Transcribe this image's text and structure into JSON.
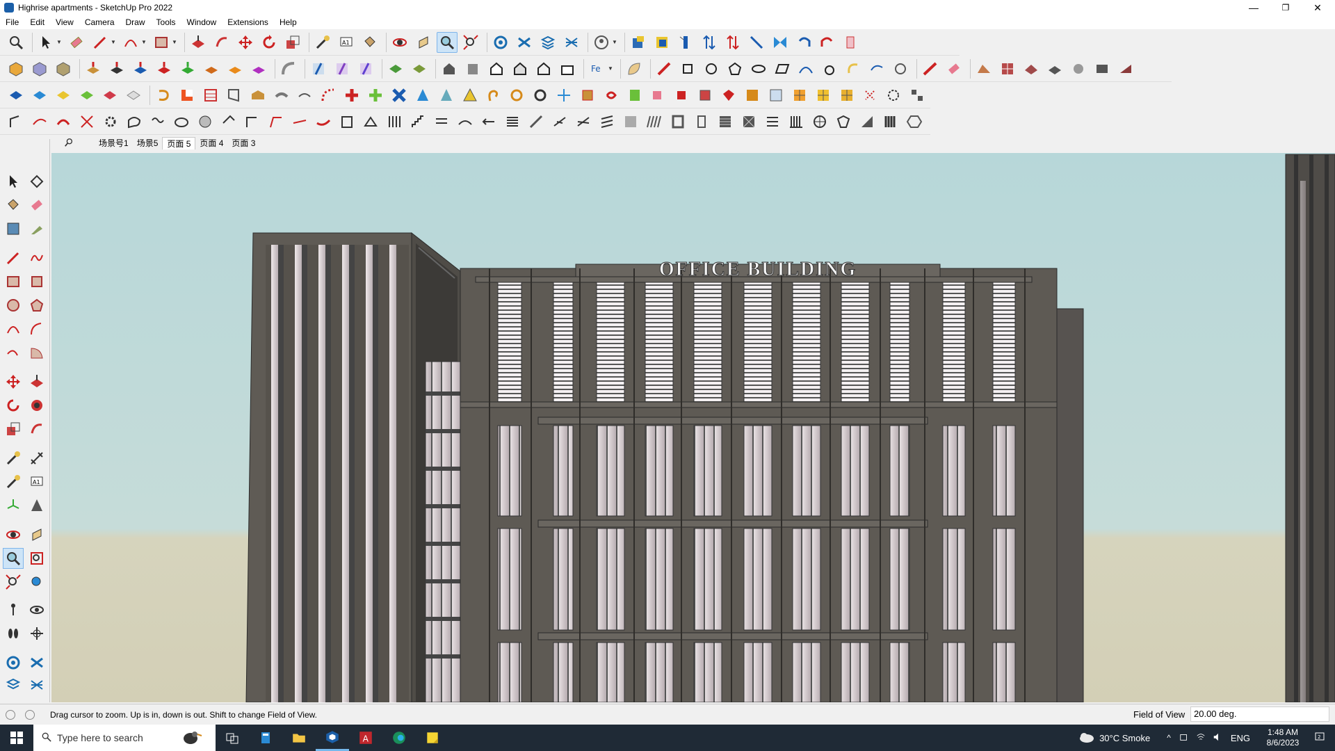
{
  "window": {
    "title": "Highrise apartments - SketchUp Pro 2022",
    "minimize": "—",
    "restore": "❐",
    "close": "✕"
  },
  "menu": [
    "File",
    "Edit",
    "View",
    "Camera",
    "Draw",
    "Tools",
    "Window",
    "Extensions",
    "Help"
  ],
  "scenes": {
    "tabs": [
      "场景号1",
      "场景5",
      "页面 5",
      "页面 4",
      "页面 3"
    ],
    "active_index": 2
  },
  "viewport": {
    "building_sign": "OFFICE BUILDING",
    "colors": {
      "sky": "#b7d7d9",
      "ground": "#d3cfb6",
      "facade": "#5e5a54",
      "glass": "#d8d0d2"
    }
  },
  "status": {
    "message": "Drag cursor to zoom.  Up is in, down is out. Shift to change Field of View.",
    "vcb_label": "Field of View",
    "vcb_value": "20.00 deg."
  },
  "taskbar": {
    "search_placeholder": "Type here to search",
    "weather": "30°C  Smoke",
    "language": "ENG",
    "time": "1:48 AM",
    "date": "8/6/2023"
  }
}
